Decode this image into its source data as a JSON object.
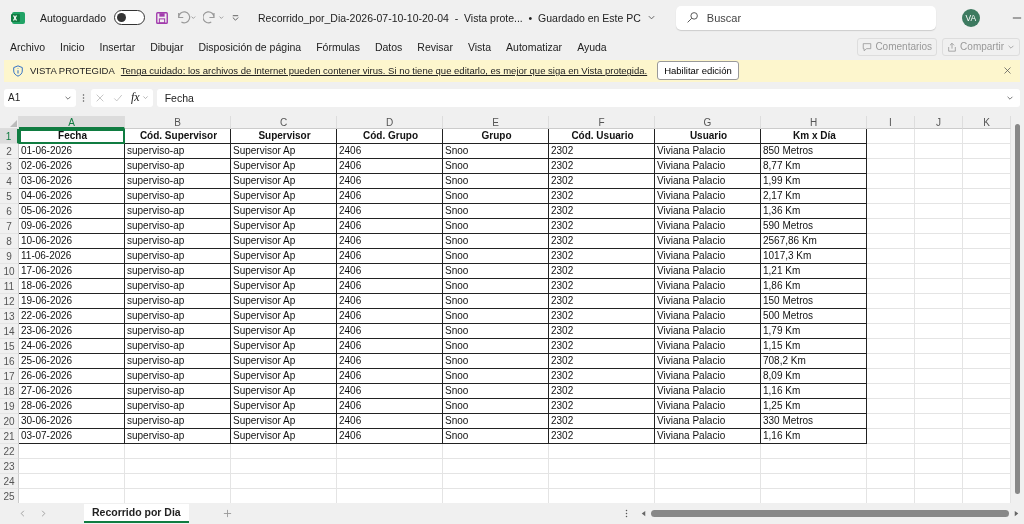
{
  "titlebar": {
    "autosave": {
      "label": "Autoguardado",
      "on": false
    },
    "title": "Recorrido_por_Dia-2026-07-10-10-20-04  -  Vista prote...  •  Guardado en Este PC",
    "search": {
      "placeholder": "Buscar"
    },
    "avatar": "VA"
  },
  "menu": {
    "items": [
      "Archivo",
      "Inicio",
      "Insertar",
      "Dibujar",
      "Disposición de página",
      "Fórmulas",
      "Datos",
      "Revisar",
      "Vista",
      "Automatizar",
      "Ayuda"
    ],
    "comments": {
      "label": "Comentarios",
      "disabled": true
    },
    "share": {
      "label": "Compartir",
      "disabled": true
    }
  },
  "protected_bar": {
    "title": "VISTA PROTEGIDA",
    "message": "Tenga cuidado: los archivos de Internet pueden contener virus. Si no tiene que editarlo, es mejor que siga en Vista protegida.",
    "button": "Habilitar edición"
  },
  "formula_bar": {
    "name_box": "A1",
    "fx": "fx",
    "value": "Fecha"
  },
  "sheet": {
    "columns": [
      {
        "label": "A",
        "selected": true
      },
      {
        "label": "B",
        "selected": false
      },
      {
        "label": "C",
        "selected": false
      },
      {
        "label": "D",
        "selected": false
      },
      {
        "label": "E",
        "selected": false
      },
      {
        "label": "F",
        "selected": false
      },
      {
        "label": "G",
        "selected": false
      },
      {
        "label": "H",
        "selected": false
      },
      {
        "label": "I",
        "selected": false
      },
      {
        "label": "J",
        "selected": false
      },
      {
        "label": "K",
        "selected": false
      }
    ],
    "row_numbers": [
      {
        "label": "1",
        "selected": true
      },
      {
        "label": "2",
        "selected": false
      },
      {
        "label": "3",
        "selected": false
      },
      {
        "label": "4",
        "selected": false
      },
      {
        "label": "5",
        "selected": false
      },
      {
        "label": "6",
        "selected": false
      },
      {
        "label": "7",
        "selected": false
      },
      {
        "label": "8",
        "selected": false
      },
      {
        "label": "9",
        "selected": false
      },
      {
        "label": "10",
        "selected": false
      },
      {
        "label": "11",
        "selected": false
      },
      {
        "label": "12",
        "selected": false
      },
      {
        "label": "13",
        "selected": false
      },
      {
        "label": "14",
        "selected": false
      },
      {
        "label": "15",
        "selected": false
      },
      {
        "label": "16",
        "selected": false
      },
      {
        "label": "17",
        "selected": false
      },
      {
        "label": "18",
        "selected": false
      },
      {
        "label": "19",
        "selected": false
      },
      {
        "label": "20",
        "selected": false
      },
      {
        "label": "21",
        "selected": false
      },
      {
        "label": "22",
        "selected": false
      },
      {
        "label": "23",
        "selected": false
      },
      {
        "label": "24",
        "selected": false
      },
      {
        "label": "25",
        "selected": false
      }
    ],
    "header": [
      "Fecha",
      "Cód. Supervisor",
      "Supervisor",
      "Cód. Grupo",
      "Grupo",
      "Cód. Usuario",
      "Usuario",
      "Km x Día"
    ],
    "rows": [
      [
        "01-06-2026",
        "superviso-ap",
        "Supervisor Ap",
        "2406",
        "Snoo",
        "2302",
        "Viviana Palacio",
        "850 Metros"
      ],
      [
        "02-06-2026",
        "superviso-ap",
        "Supervisor Ap",
        "2406",
        "Snoo",
        "2302",
        "Viviana Palacio",
        "8,77 Km"
      ],
      [
        "03-06-2026",
        "superviso-ap",
        "Supervisor Ap",
        "2406",
        "Snoo",
        "2302",
        "Viviana Palacio",
        "1,99 Km"
      ],
      [
        "04-06-2026",
        "superviso-ap",
        "Supervisor Ap",
        "2406",
        "Snoo",
        "2302",
        "Viviana Palacio",
        "2,17 Km"
      ],
      [
        "05-06-2026",
        "superviso-ap",
        "Supervisor Ap",
        "2406",
        "Snoo",
        "2302",
        "Viviana Palacio",
        "1,36 Km"
      ],
      [
        "09-06-2026",
        "superviso-ap",
        "Supervisor Ap",
        "2406",
        "Snoo",
        "2302",
        "Viviana Palacio",
        "590 Metros"
      ],
      [
        "10-06-2026",
        "superviso-ap",
        "Supervisor Ap",
        "2406",
        "Snoo",
        "2302",
        "Viviana Palacio",
        "2567,86 Km"
      ],
      [
        "11-06-2026",
        "superviso-ap",
        "Supervisor Ap",
        "2406",
        "Snoo",
        "2302",
        "Viviana Palacio",
        "1017,3 Km"
      ],
      [
        "17-06-2026",
        "superviso-ap",
        "Supervisor Ap",
        "2406",
        "Snoo",
        "2302",
        "Viviana Palacio",
        "1,21 Km"
      ],
      [
        "18-06-2026",
        "superviso-ap",
        "Supervisor Ap",
        "2406",
        "Snoo",
        "2302",
        "Viviana Palacio",
        "1,86 Km"
      ],
      [
        "19-06-2026",
        "superviso-ap",
        "Supervisor Ap",
        "2406",
        "Snoo",
        "2302",
        "Viviana Palacio",
        "150 Metros"
      ],
      [
        "22-06-2026",
        "superviso-ap",
        "Supervisor Ap",
        "2406",
        "Snoo",
        "2302",
        "Viviana Palacio",
        "500 Metros"
      ],
      [
        "23-06-2026",
        "superviso-ap",
        "Supervisor Ap",
        "2406",
        "Snoo",
        "2302",
        "Viviana Palacio",
        "1,79 Km"
      ],
      [
        "24-06-2026",
        "superviso-ap",
        "Supervisor Ap",
        "2406",
        "Snoo",
        "2302",
        "Viviana Palacio",
        "1,15 Km"
      ],
      [
        "25-06-2026",
        "superviso-ap",
        "Supervisor Ap",
        "2406",
        "Snoo",
        "2302",
        "Viviana Palacio",
        "708,2 Km"
      ],
      [
        "26-06-2026",
        "superviso-ap",
        "Supervisor Ap",
        "2406",
        "Snoo",
        "2302",
        "Viviana Palacio",
        "8,09 Km"
      ],
      [
        "27-06-2026",
        "superviso-ap",
        "Supervisor Ap",
        "2406",
        "Snoo",
        "2302",
        "Viviana Palacio",
        "1,16 Km"
      ],
      [
        "28-06-2026",
        "superviso-ap",
        "Supervisor Ap",
        "2406",
        "Snoo",
        "2302",
        "Viviana Palacio",
        "1,25 Km"
      ],
      [
        "30-06-2026",
        "superviso-ap",
        "Supervisor Ap",
        "2406",
        "Snoo",
        "2302",
        "Viviana Palacio",
        "330 Metros"
      ],
      [
        "03-07-2026",
        "superviso-ap",
        "Supervisor Ap",
        "2406",
        "Snoo",
        "2302",
        "Viviana Palacio",
        "1,16 Km"
      ]
    ]
  },
  "sheet_tabs": [
    {
      "label": "Recorrido por Dia",
      "selected": true
    }
  ]
}
